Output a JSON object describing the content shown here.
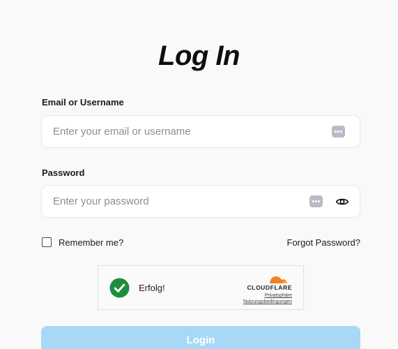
{
  "title": "Log In",
  "email": {
    "label": "Email or Username",
    "placeholder": "Enter your email or username",
    "value": ""
  },
  "password": {
    "label": "Password",
    "placeholder": "Enter your password",
    "value": ""
  },
  "remember": {
    "label": "Remember me?",
    "checked": false
  },
  "forgot_label": "Forgot Password?",
  "captcha": {
    "status": "Erfolg!",
    "brand": "CLOUDFLARE",
    "privacy_label": "Privatsphäre",
    "terms_label": "Nutzungsbedingungen",
    "status_color": "#1e8e3e",
    "brand_color": "#f38020"
  },
  "login_label": "Login",
  "colors": {
    "login_button": "#a9d8f6",
    "password_manager_icon": "#b9bcc6"
  },
  "icons": [
    "password-manager-icon",
    "eye-icon",
    "success-check-icon",
    "cloudflare-logo"
  ]
}
